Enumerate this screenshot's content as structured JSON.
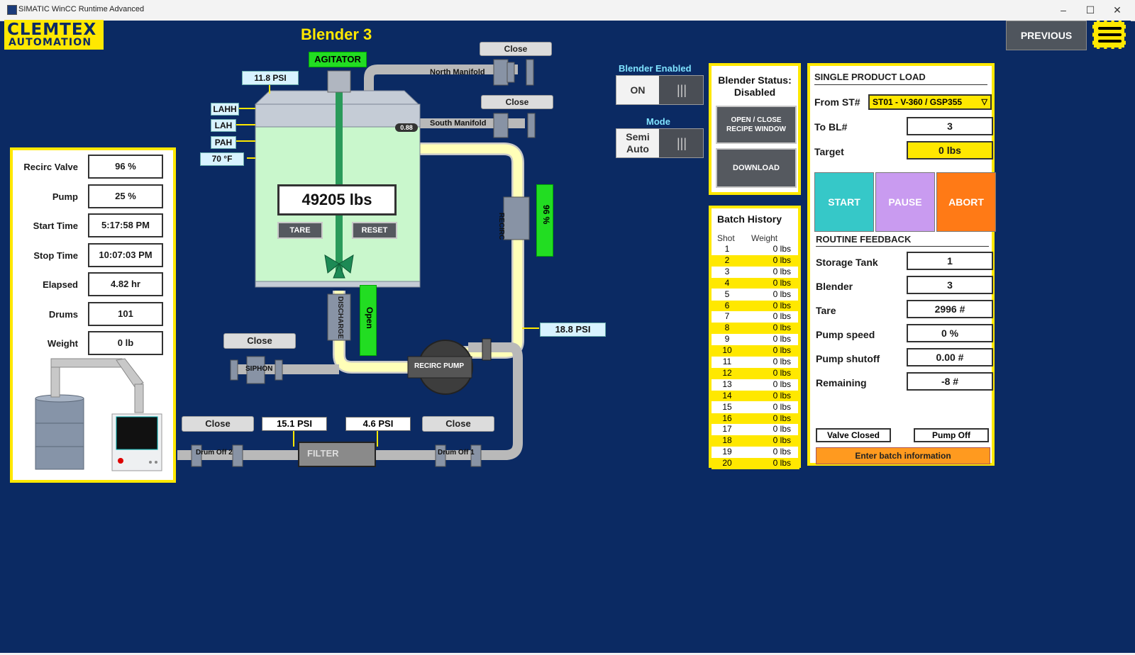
{
  "window": {
    "title": "SIMATIC WinCC Runtime Advanced",
    "controls": [
      "–",
      "☐",
      "✕"
    ]
  },
  "header": {
    "logo_line1": "CLEMTEX",
    "logo_line2": "AUTOMATION",
    "screen_title": "Blender 3",
    "previous_label": "PREVIOUS"
  },
  "left_panel": {
    "rows": [
      {
        "label": "Recirc Valve",
        "value": "96 %"
      },
      {
        "label": "Pump",
        "value": "25 %"
      },
      {
        "label": "Start Time",
        "value": "5:17:58 PM"
      },
      {
        "label": "Stop Time",
        "value": "10:07:03 PM"
      },
      {
        "label": "Elapsed",
        "value": "4.82 hr"
      },
      {
        "label": "Drums",
        "value": "101"
      },
      {
        "label": "Weight",
        "value": "0 lb"
      }
    ]
  },
  "process": {
    "agitator_label": "AGITATOR",
    "tank_pressure": "11.8 PSI",
    "level_tags": [
      "LAHH",
      "LAH",
      "PAH"
    ],
    "temperature": "70 °F",
    "tank_small_value": "0.88",
    "weight_display": "49205 lbs",
    "tare_label": "TARE",
    "reset_label": "RESET",
    "north_manifold_label": "North Manifold",
    "north_valve_state": "Close",
    "south_manifold_label": "South Manifold",
    "south_valve_state": "Close",
    "recirc_label": "RECIRC",
    "recirc_valve_value": "96 %",
    "discharge_label": "DISCHARGE",
    "discharge_state": "Open",
    "pump_pressure": "18.8 PSI",
    "recirc_pump_label": "RECIRC PUMP",
    "siphon_label": "SIPHON",
    "siphon_state": "Close",
    "drum_off_2_label": "Drum Off 2",
    "drum_off_2_state": "Close",
    "filter_in_pressure": "15.1 PSI",
    "filter_label": "FILTER",
    "filter_out_pressure": "4.6 PSI",
    "drum_off_1_label": "Drum Off 1",
    "drum_off_1_state": "Close"
  },
  "controls": {
    "blender_enabled_label": "Blender Enabled",
    "blender_enabled_value": "ON",
    "mode_label": "Mode",
    "mode_value_line1": "Semi",
    "mode_value_line2": "Auto",
    "toggle_glyph": "|||"
  },
  "status": {
    "title_line1": "Blender Status:",
    "title_line2": "Disabled",
    "recipe_btn_line1": "OPEN / CLOSE",
    "recipe_btn_line2": "RECIPE WINDOW",
    "download_label": "DOWNLOAD"
  },
  "batch_history": {
    "title": "Batch History",
    "col_shot": "Shot",
    "col_weight": "Weight",
    "rows": [
      {
        "shot": "1",
        "weight": "0 lbs"
      },
      {
        "shot": "2",
        "weight": "0 lbs"
      },
      {
        "shot": "3",
        "weight": "0 lbs"
      },
      {
        "shot": "4",
        "weight": "0 lbs"
      },
      {
        "shot": "5",
        "weight": "0 lbs"
      },
      {
        "shot": "6",
        "weight": "0 lbs"
      },
      {
        "shot": "7",
        "weight": "0 lbs"
      },
      {
        "shot": "8",
        "weight": "0 lbs"
      },
      {
        "shot": "9",
        "weight": "0 lbs"
      },
      {
        "shot": "10",
        "weight": "0 lbs"
      },
      {
        "shot": "11",
        "weight": "0 lbs"
      },
      {
        "shot": "12",
        "weight": "0 lbs"
      },
      {
        "shot": "13",
        "weight": "0 lbs"
      },
      {
        "shot": "14",
        "weight": "0 lbs"
      },
      {
        "shot": "15",
        "weight": "0 lbs"
      },
      {
        "shot": "16",
        "weight": "0 lbs"
      },
      {
        "shot": "17",
        "weight": "0 lbs"
      },
      {
        "shot": "18",
        "weight": "0 lbs"
      },
      {
        "shot": "19",
        "weight": "0 lbs"
      },
      {
        "shot": "20",
        "weight": "0 lbs"
      }
    ]
  },
  "product_load": {
    "title": "SINGLE PRODUCT LOAD",
    "from_label": "From ST#",
    "from_value": "ST01 - V-360 / GSP355",
    "to_label": "To BL#",
    "to_value": "3",
    "target_label": "Target",
    "target_value": "0 lbs",
    "start_label": "START",
    "pause_label": "PAUSE",
    "abort_label": "ABORT",
    "feedback_title": "ROUTINE FEEDBACK",
    "feedback": [
      {
        "label": "Storage Tank",
        "value": "1"
      },
      {
        "label": "Blender",
        "value": "3"
      },
      {
        "label": "Tare",
        "value": "2996 #"
      },
      {
        "label": "Pump speed",
        "value": "0 %"
      },
      {
        "label": "Pump shutoff",
        "value": "0.00 #"
      },
      {
        "label": "Remaining",
        "value": "-8 #"
      }
    ],
    "valve_status": "Valve Closed",
    "pump_status": "Pump Off",
    "enter_batch_label": "Enter batch information"
  },
  "colors": {
    "background": "#0b2a63",
    "accent_yellow": "#ffe800",
    "start": "#36c8c8",
    "pause": "#c99bf0",
    "abort": "#ff7a16",
    "enter_batch": "#ff9a1f",
    "indicator_green": "#22dd22",
    "tank_fill": "#c9f7cc"
  }
}
